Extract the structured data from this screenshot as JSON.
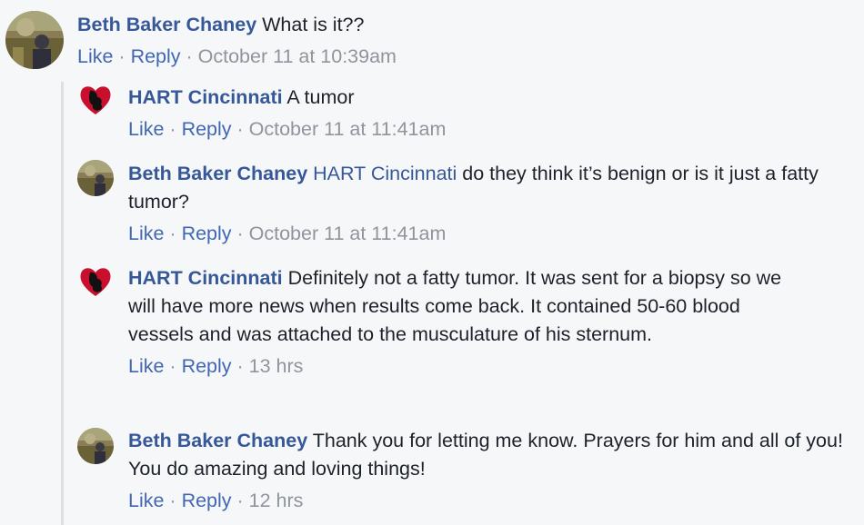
{
  "comments": [
    {
      "author": "Beth Baker Chaney",
      "mention": "",
      "text": "What is it??",
      "like": "Like",
      "reply": "Reply",
      "time": "October 11 at 10:39am"
    },
    {
      "author": "HART Cincinnati",
      "mention": "",
      "text": "A tumor",
      "like": "Like",
      "reply": "Reply",
      "time": "October 11 at 11:41am"
    },
    {
      "author": "Beth Baker Chaney",
      "mention": "HART Cincinnati",
      "text": "do they think it’s benign or is it just a fatty tumor?",
      "like": "Like",
      "reply": "Reply",
      "time": "October 11 at 11:41am"
    },
    {
      "author": "HART Cincinnati",
      "mention": "",
      "text": "Definitely not a fatty tumor. It was sent for a biopsy so we will have more news when results come back. It contained 50-60 blood vessels and was attached to the musculature of his sternum.",
      "like": "Like",
      "reply": "Reply",
      "time": "13 hrs"
    },
    {
      "author": "Beth Baker Chaney",
      "mention": "",
      "text": "Thank you for letting me know. Prayers for him and all of you! You do amazing and loving things!",
      "like": "Like",
      "reply": "Reply",
      "time": "12 hrs"
    }
  ],
  "icons": {
    "beth_avatar": "user-photo-avatar",
    "hart_avatar": "red-heart-logo-avatar"
  },
  "colors": {
    "author": "#365899",
    "link": "#4267b2",
    "meta": "#90949c",
    "text": "#1d2129",
    "background": "#f6f7f9",
    "logo_red": "#c8102e"
  }
}
